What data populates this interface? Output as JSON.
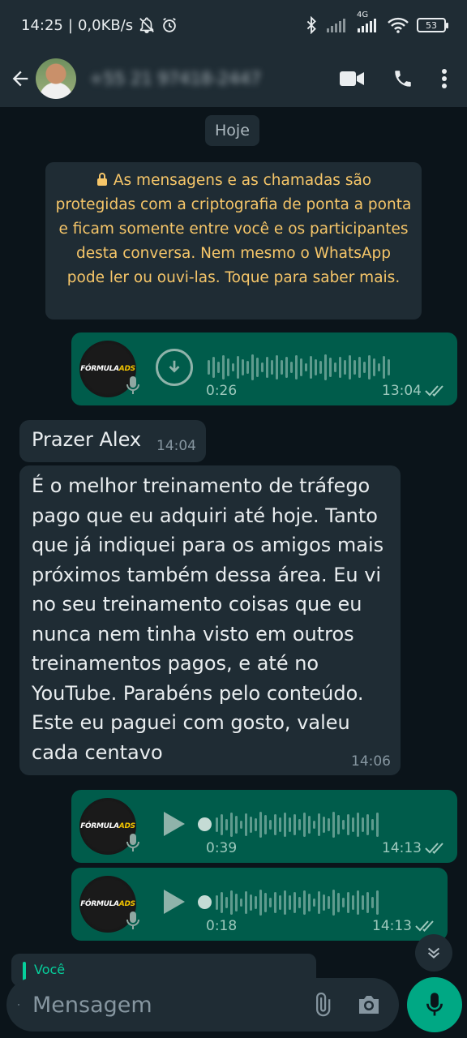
{
  "statusbar": {
    "time": "14:25",
    "network_speed": "0,0KB/s",
    "network_type": "4G",
    "battery": "53"
  },
  "header": {
    "contact_name": "+55 21 97418-2447",
    "icons": [
      "back-arrow-icon",
      "video-call-icon",
      "voice-call-icon",
      "more-menu-icon"
    ]
  },
  "chat": {
    "date_label": "Hoje",
    "encryption_notice": "As mensagens e as chamadas são protegidas com a criptografia de ponta a ponta e ficam somente entre você e os participantes desta conversa. Nem mesmo o WhatsApp pode ler ou ouvi-las. Toque para saber mais.",
    "messages": [
      {
        "type": "voice",
        "direction": "outgoing",
        "duration": "0:26",
        "time": "13:04",
        "state": "download",
        "thumb_text": "FÓRMULA",
        "thumb_badge": "ADS"
      },
      {
        "type": "text",
        "direction": "incoming",
        "text": "Prazer Alex",
        "time": "14:04"
      },
      {
        "type": "text",
        "direction": "incoming",
        "text": "É o melhor treinamento de tráfego pago que eu adquiri até hoje. Tanto que já indiquei para os amigos mais próximos também dessa área. Eu vi no seu treinamento coisas que eu nunca nem tinha visto em outros treinamentos pagos, e até no YouTube. Parabéns pelo conteúdo. Este eu paguei com gosto, valeu cada centavo",
        "time": "14:06"
      },
      {
        "type": "voice",
        "direction": "outgoing",
        "duration": "0:39",
        "time": "14:13",
        "state": "play",
        "thumb_text": "FÓRMULA",
        "thumb_badge": "ADS"
      },
      {
        "type": "voice",
        "direction": "outgoing",
        "duration": "0:18",
        "time": "14:13",
        "state": "play",
        "thumb_text": "FÓRMULA",
        "thumb_badge": "ADS"
      }
    ],
    "reply_peek": "Você"
  },
  "composer": {
    "placeholder": "Mensagem"
  },
  "colors": {
    "outgoing_bubble": "#005c4b",
    "incoming_bubble": "#1f2c34",
    "accent": "#00a884",
    "notice_text": "#f6c669"
  }
}
